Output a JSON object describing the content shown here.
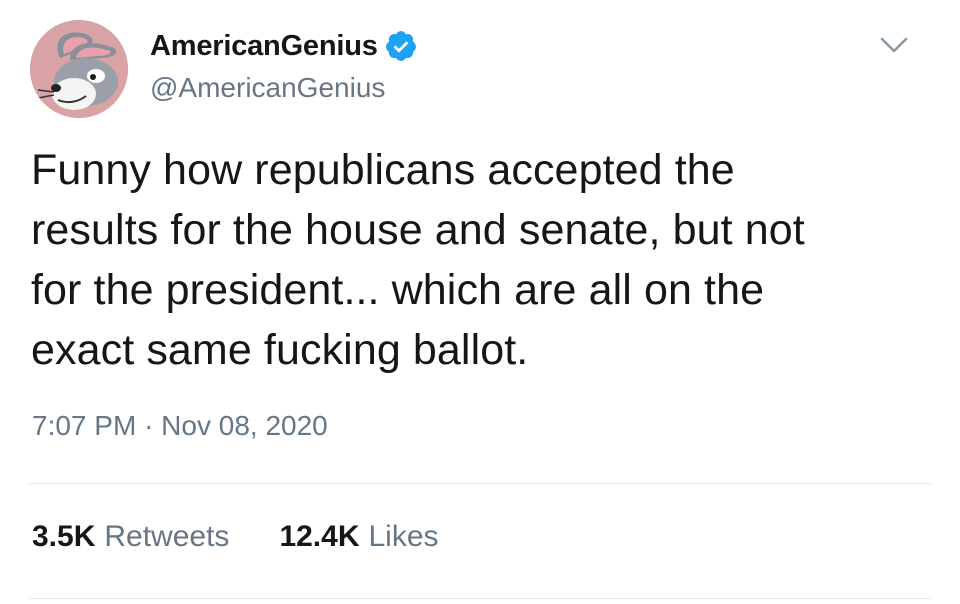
{
  "user": {
    "display_name": "AmericanGenius",
    "handle": "@AmericanGenius",
    "verified": true,
    "avatar_icon": "bugs-bunny-avatar-icon"
  },
  "tweet": {
    "text": "Funny how republicans accepted the\nresults for the house and senate, but not\nfor the president... which are all on the\nexact same fucking ballot.",
    "time": "7:07 PM",
    "separator": "·",
    "date": "Nov 08, 2020"
  },
  "stats": {
    "retweets_count": "3.5K",
    "retweets_label": "Retweets",
    "likes_count": "12.4K",
    "likes_label": "Likes"
  },
  "icons": {
    "verified": "verified-badge-icon",
    "menu": "chevron-down-icon"
  },
  "colors": {
    "text_primary": "#14171a",
    "text_secondary": "#657786",
    "verified_blue": "#1da1f2",
    "divider": "#e1e8ed",
    "avatar_bg": "#d9a3a6"
  }
}
